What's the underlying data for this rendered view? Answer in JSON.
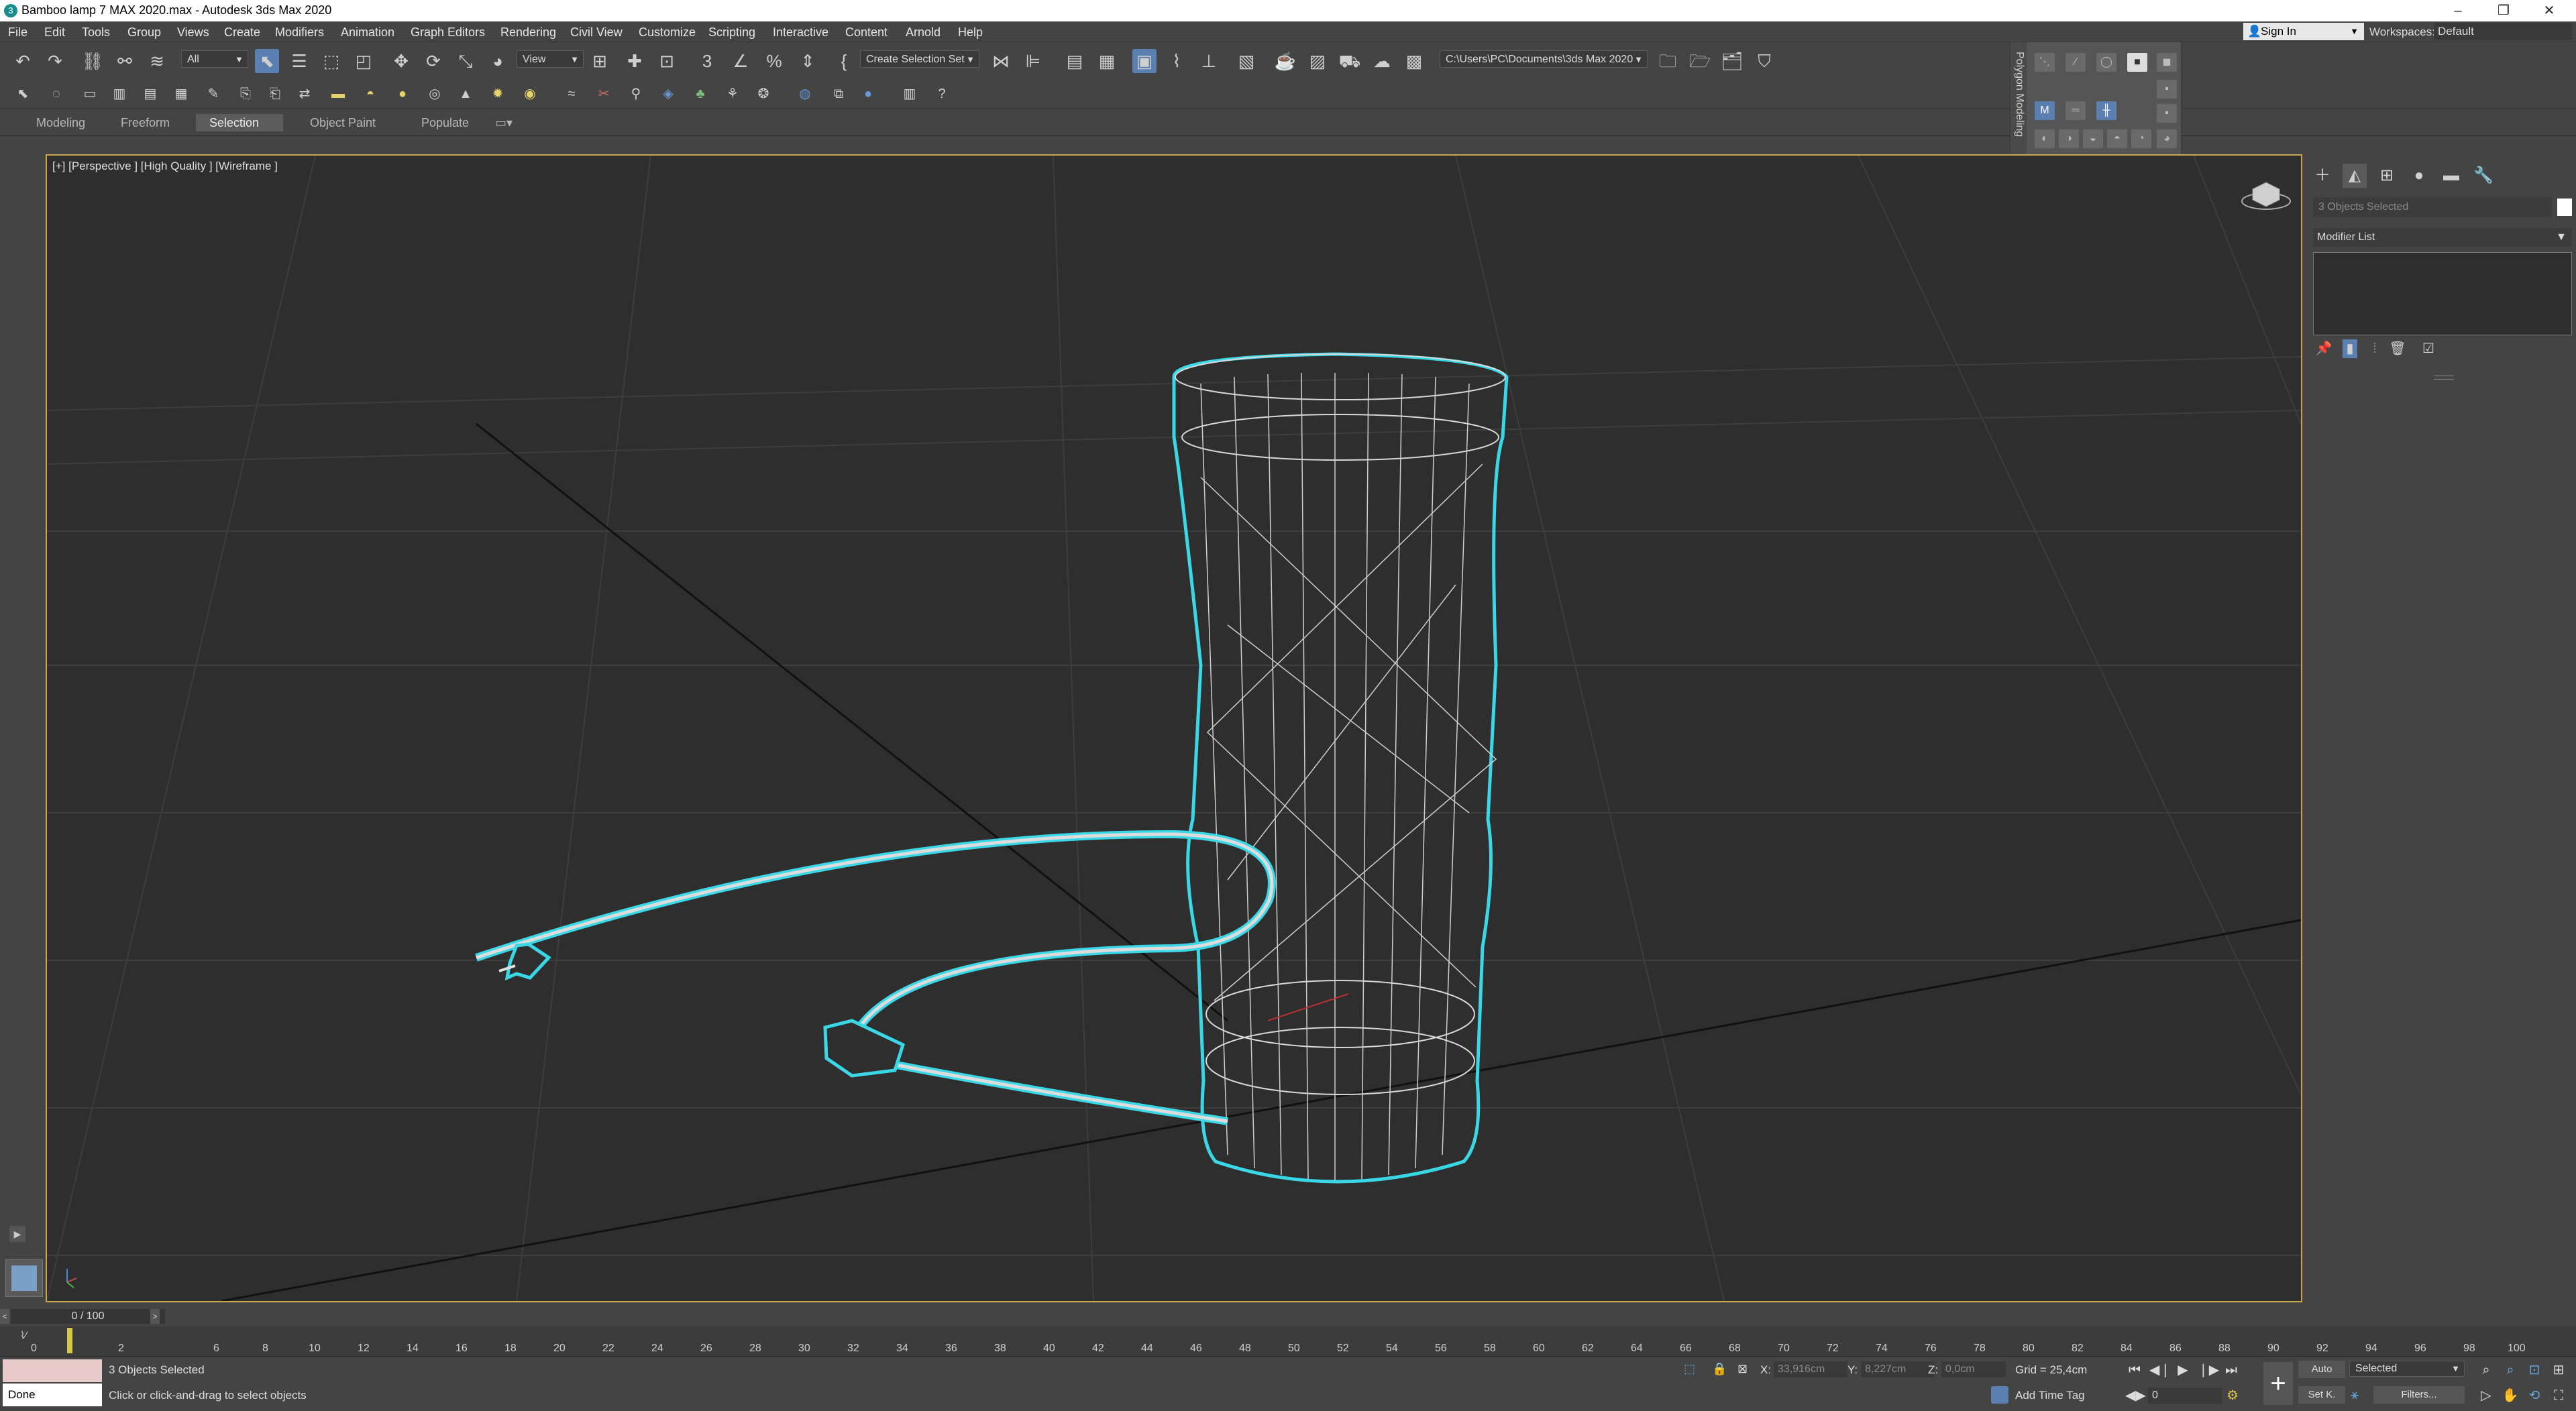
{
  "window": {
    "title": "Bamboo lamp 7 MAX 2020.max - Autodesk 3ds Max 2020"
  },
  "menu": [
    "File",
    "Edit",
    "Tools",
    "Group",
    "Views",
    "Create",
    "Modifiers",
    "Animation",
    "Graph Editors",
    "Rendering",
    "Civil View",
    "Customize",
    "Scripting",
    "Interactive",
    "Content",
    "Arnold",
    "Help"
  ],
  "account": {
    "sign_in": "Sign In",
    "workspaces_label": "Workspaces:",
    "workspace": "Default"
  },
  "toolbar": {
    "selection_filter": "All",
    "ref_coord": "View",
    "selection_set": "Create Selection Set",
    "project_path": "C:\\Users\\PC\\Documents\\3ds Max 2020"
  },
  "ribbon": {
    "tabs": [
      "Modeling",
      "Freeform",
      "Selection",
      "Object Paint",
      "Populate"
    ],
    "selected": "Selection"
  },
  "floater": {
    "title": "Polygon Modeling"
  },
  "viewport": {
    "label": "[+] [Perspective ] [High Quality ] [Wireframe ]"
  },
  "command_panel": {
    "object_name": "3 Objects Selected",
    "modifier_list": "Modifier List"
  },
  "timeline": {
    "frame": "0 / 100",
    "ticks": [
      "0",
      "2",
      "6",
      "8",
      "10",
      "12",
      "14",
      "16",
      "18",
      "20",
      "22",
      "24",
      "26",
      "28",
      "30",
      "32",
      "34",
      "36",
      "38",
      "40",
      "42",
      "44",
      "46",
      "48",
      "50",
      "52",
      "54",
      "56",
      "58",
      "60",
      "62",
      "64",
      "66",
      "68",
      "70",
      "72",
      "74",
      "76",
      "78",
      "80",
      "82",
      "84",
      "86",
      "88",
      "90",
      "92",
      "94",
      "96",
      "98",
      "100"
    ]
  },
  "status": {
    "selection": "3 Objects Selected",
    "prompt": "Click or click-and-drag to select objects",
    "listener": "Done",
    "x_label": "X:",
    "x": "33,916cm",
    "y_label": "Y:",
    "y": "8,227cm",
    "z_label": "Z:",
    "z": "0,0cm",
    "grid": "Grid = 25,4cm",
    "add_time_tag": "Add Time Tag",
    "auto": "Auto",
    "key_filter": "Selected",
    "set_key": "Set K.",
    "filters": "Filters...",
    "frame_field": "0"
  },
  "colors": {
    "selection_outline": "#3ad8e6",
    "viewport_bg": "#2e2e2e",
    "viewport_border": "#c8a84a"
  }
}
